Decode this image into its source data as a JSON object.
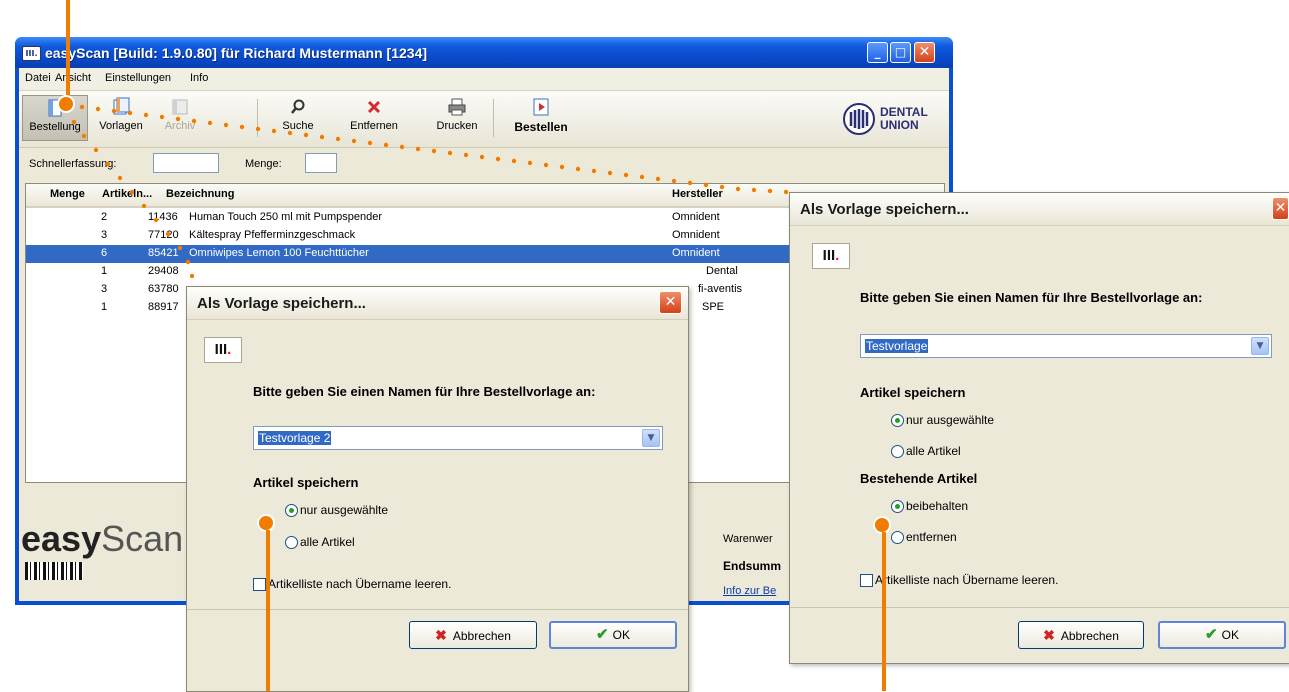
{
  "main_window": {
    "title": "easyScan [Build: 1.9.0.80]  für Richard Mustermann [1234]",
    "app_icon": "III.",
    "menu": [
      "Datei",
      "Ansicht",
      "Einstellungen",
      "Info"
    ],
    "toolbar": [
      {
        "label": "Bestellung",
        "icon": "order-icon"
      },
      {
        "label": "Vorlagen",
        "icon": "templates-icon"
      },
      {
        "label": "Archiv",
        "icon": "archive-icon"
      },
      {
        "label": "Suche",
        "icon": "search-icon"
      },
      {
        "label": "Entfernen",
        "icon": "remove-icon"
      },
      {
        "label": "Drucken",
        "icon": "printer-icon"
      },
      {
        "label": "Bestellen",
        "icon": "submit-order-icon"
      }
    ],
    "logo_text_1": "DENTAL",
    "logo_text_2": "UNION",
    "quick_entry_label": "Schnellerfassung:",
    "quantity_label": "Menge:",
    "table": {
      "headers": [
        "Menge",
        "Artikeln...",
        "Bezeichnung",
        "Hersteller"
      ],
      "rows": [
        {
          "menge": "2",
          "artikel": "11436",
          "bezeichnung": "Human Touch 250 ml mit Pumpspender",
          "hersteller": "Omnident"
        },
        {
          "menge": "3",
          "artikel": "77120",
          "bezeichnung": "Kältespray Pfefferminzgeschmack",
          "hersteller": "Omnident"
        },
        {
          "menge": "6",
          "artikel": "85421",
          "bezeichnung": "Omniwipes Lemon 100 Feuchttücher",
          "hersteller": "Omnident"
        },
        {
          "menge": "1",
          "artikel": "29408",
          "bezeichnung": "",
          "hersteller": "Dental"
        },
        {
          "menge": "3",
          "artikel": "63780",
          "bezeichnung": "",
          "hersteller": "fi-aventis"
        },
        {
          "menge": "1",
          "artikel": "88917",
          "bezeichnung": "",
          "hersteller": "SPE"
        }
      ]
    },
    "brand_part1": "easy",
    "brand_part2": "Scan",
    "summary_waren": "Warenwer",
    "summary_end": "Endsumm",
    "summary_info": "Info zur Be"
  },
  "dialog_left": {
    "title": "Als Vorlage speichern...",
    "logo": "III",
    "prompt": "Bitte geben Sie einen Namen für Ihre Bestellvorlage an:",
    "template_name": "Testvorlage 2",
    "section_save": "Artikel speichern",
    "option_selected": "nur ausgewählte",
    "option_all": "alle Artikel",
    "clear_list": "Artikelliste nach Übername leeren.",
    "cancel": "Abbrechen",
    "ok": "OK"
  },
  "dialog_right": {
    "title": "Als Vorlage speichern...",
    "logo": "III",
    "prompt": "Bitte geben Sie einen Namen für Ihre Bestellvorlage an:",
    "template_name": "Testvorlage",
    "section_save": "Artikel speichern",
    "option_selected": "nur ausgewählte",
    "option_all": "alle Artikel",
    "section_existing": "Bestehende Artikel",
    "option_keep": "beibehalten",
    "option_remove": "entfernen",
    "clear_list": "Artikelliste nach Übername leeren.",
    "cancel": "Abbrechen",
    "ok": "OK"
  },
  "colors": {
    "callout": "#f07c00",
    "xp_title_blue": "#0a4fd2",
    "selection": "#316ac5"
  }
}
